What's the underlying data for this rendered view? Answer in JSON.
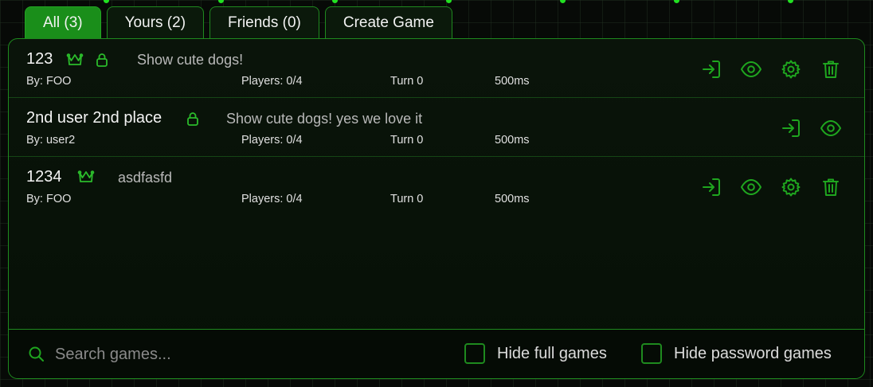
{
  "tabs": [
    {
      "label": "All (3)",
      "active": true
    },
    {
      "label": "Yours (2)",
      "active": false
    },
    {
      "label": "Friends (0)",
      "active": false
    },
    {
      "label": "Create Game",
      "active": false
    }
  ],
  "games": [
    {
      "name": "123",
      "owner_crown": true,
      "locked": true,
      "description": "Show cute dogs!",
      "by": "By: FOO",
      "players": "Players: 0/4",
      "turn": "Turn 0",
      "tick": "500ms",
      "actions": [
        "join-icon",
        "eye-icon",
        "gear-icon",
        "trash-icon"
      ]
    },
    {
      "name": "2nd user 2nd place",
      "owner_crown": false,
      "locked": true,
      "description": "Show cute dogs! yes we love it",
      "by": "By: user2",
      "players": "Players: 0/4",
      "turn": "Turn 0",
      "tick": "500ms",
      "actions": [
        "join-icon",
        "eye-icon"
      ]
    },
    {
      "name": "1234",
      "owner_crown": true,
      "locked": false,
      "description": "asdfasfd",
      "by": "By: FOO",
      "players": "Players: 0/4",
      "turn": "Turn 0",
      "tick": "500ms",
      "actions": [
        "join-icon",
        "eye-icon",
        "gear-icon",
        "trash-icon"
      ]
    }
  ],
  "footer": {
    "search_placeholder": "Search games...",
    "search_value": "",
    "hide_full_label": "Hide full games",
    "hide_full_checked": false,
    "hide_password_label": "Hide password games",
    "hide_password_checked": false
  },
  "colors": {
    "accent": "#1fa61f",
    "active_tab": "#1a8e1a",
    "border": "#1e8a1e"
  }
}
